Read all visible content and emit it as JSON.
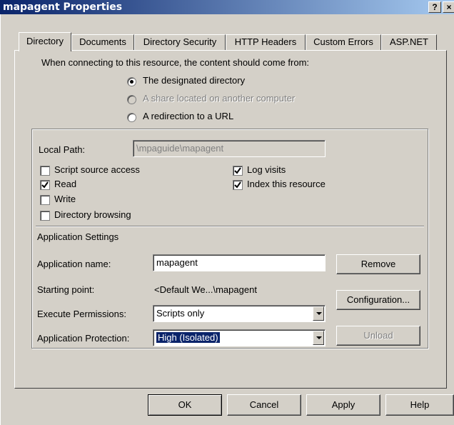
{
  "window": {
    "title": "mapagent Properties",
    "help_btn": "?",
    "close_btn": "×"
  },
  "tabs": [
    "Directory",
    "Documents",
    "Directory Security",
    "HTTP Headers",
    "Custom Errors",
    "ASP.NET"
  ],
  "content_from": {
    "label": "When connecting to this resource, the content should come from:",
    "options": [
      "The designated directory",
      "A share located on another computer",
      "A redirection to a URL"
    ],
    "selected_index": 0
  },
  "local_path": {
    "label": "Local Path:",
    "value": "\\mpaguide\\mapagent"
  },
  "checkboxes": {
    "script_source_access": {
      "label": "Script source access",
      "checked": false
    },
    "read": {
      "label": "Read",
      "checked": true
    },
    "write": {
      "label": "Write",
      "checked": false
    },
    "directory_browsing": {
      "label": "Directory browsing",
      "checked": false
    },
    "log_visits": {
      "label": "Log visits",
      "checked": true
    },
    "index_resource": {
      "label": "Index this resource",
      "checked": true
    }
  },
  "app_settings": {
    "heading": "Application Settings",
    "app_name_label": "Application name:",
    "app_name_value": "mapagent",
    "remove_btn": "Remove",
    "starting_point_label": "Starting point:",
    "starting_point_value": "<Default We...\\mapagent",
    "configuration_btn": "Configuration...",
    "exec_perm_label": "Execute Permissions:",
    "exec_perm_value": "Scripts only",
    "app_protection_label": "Application Protection:",
    "app_protection_value": "High (Isolated)",
    "unload_btn": "Unload"
  },
  "footer": {
    "ok": "OK",
    "cancel": "Cancel",
    "apply": "Apply",
    "help": "Help"
  }
}
